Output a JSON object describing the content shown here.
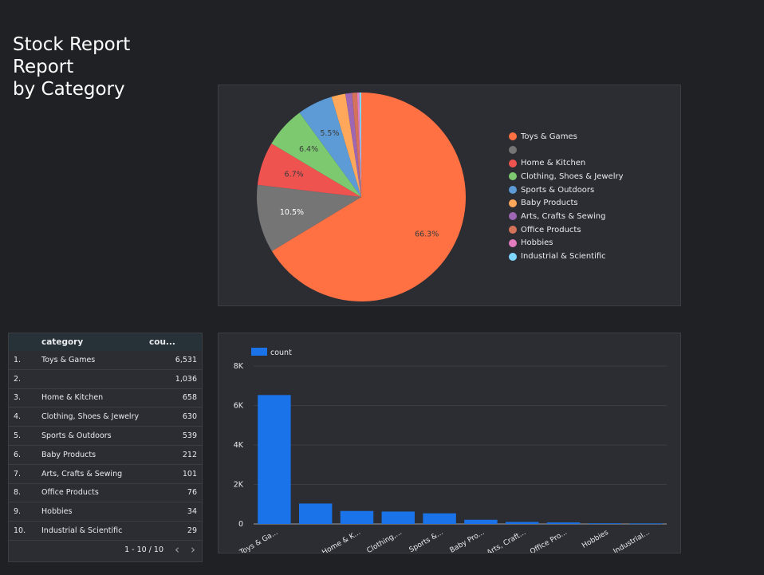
{
  "report": {
    "title_line1": "Stock Report",
    "title_line2": "Report",
    "title_line3": "by Category"
  },
  "chart_data": [
    {
      "type": "pie",
      "categories": [
        "Toys & Games",
        "",
        "Home & Kitchen",
        "Clothing, Shoes & Jewelry",
        "Sports & Outdoors",
        "Baby Products",
        "Arts, Crafts & Sewing",
        "Office Products",
        "Hobbies",
        "Industrial & Scientific"
      ],
      "values": [
        6531,
        1036,
        658,
        630,
        539,
        212,
        101,
        76,
        34,
        29
      ],
      "slice_labels": [
        "66.3%",
        "10.5%",
        "6.7%",
        "6.4%",
        "5.5%",
        "",
        "",
        "",
        "",
        ""
      ],
      "colors": [
        "#ff7043",
        "#757575",
        "#ef5350",
        "#7cc96f",
        "#5c9bd6",
        "#ffa85c",
        "#9e66b3",
        "#d4735a",
        "#e57bbf",
        "#7fd6ff"
      ],
      "legend_position": "right"
    },
    {
      "type": "bar",
      "categories": [
        "Toys & Ga...",
        "",
        "Home & K...",
        "Clothing,...",
        "Sports &...",
        "Baby Pro...",
        "Arts, Craft...",
        "Office Pro...",
        "Hobbies",
        "Industrial..."
      ],
      "series": [
        {
          "name": "count",
          "values": [
            6531,
            1036,
            658,
            630,
            539,
            212,
            101,
            76,
            34,
            29
          ]
        }
      ],
      "ylim": [
        0,
        8000
      ],
      "yticks": [
        "0",
        "2K",
        "4K",
        "6K",
        "8K"
      ],
      "ytick_values": [
        0,
        2000,
        4000,
        6000,
        8000
      ],
      "grid": true,
      "legend_position": "top-left",
      "color": "#1a73e8"
    }
  ],
  "table": {
    "headers": {
      "category": "category",
      "count": "cou..."
    },
    "rows": [
      {
        "idx": "1.",
        "category": "Toys & Games",
        "count": "6,531"
      },
      {
        "idx": "2.",
        "category": "",
        "count": "1,036"
      },
      {
        "idx": "3.",
        "category": "Home & Kitchen",
        "count": "658"
      },
      {
        "idx": "4.",
        "category": "Clothing, Shoes & Jewelry",
        "count": "630"
      },
      {
        "idx": "5.",
        "category": "Sports & Outdoors",
        "count": "539"
      },
      {
        "idx": "6.",
        "category": "Baby Products",
        "count": "212"
      },
      {
        "idx": "7.",
        "category": "Arts, Crafts & Sewing",
        "count": "101"
      },
      {
        "idx": "8.",
        "category": "Office Products",
        "count": "76"
      },
      {
        "idx": "9.",
        "category": "Hobbies",
        "count": "34"
      },
      {
        "idx": "10.",
        "category": "Industrial & Scientific",
        "count": "29"
      }
    ],
    "pagination": "1 - 10 / 10",
    "prev_icon": "chevron-left-icon",
    "next_icon": "chevron-right-icon"
  }
}
